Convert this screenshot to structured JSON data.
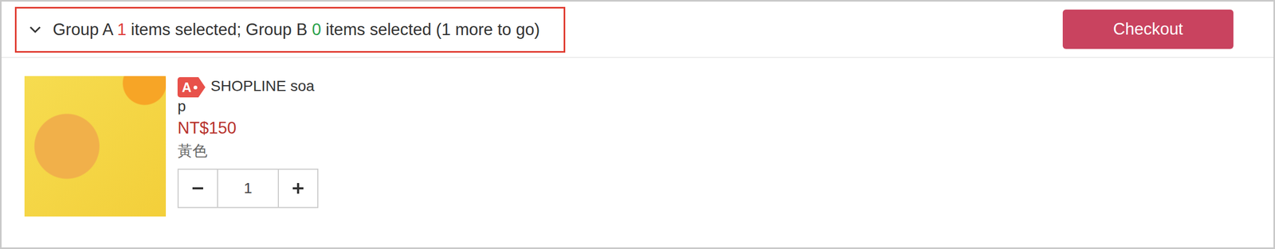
{
  "summary": {
    "expanded": true,
    "segments": [
      {
        "text": "Group A ",
        "color": "#333333"
      },
      {
        "text": "1",
        "color": "#e03e3e"
      },
      {
        "text": " items selected; Group B ",
        "color": "#333333"
      },
      {
        "text": "0",
        "color": "#2aa14b"
      },
      {
        "text": " items selected (1 more to go)",
        "color": "#333333"
      }
    ]
  },
  "checkout_button": "Checkout",
  "items": [
    {
      "tag": "A",
      "name": "SHOPLINE soap",
      "price": "NT$150",
      "variant": "黃色",
      "quantity": "1"
    }
  ]
}
